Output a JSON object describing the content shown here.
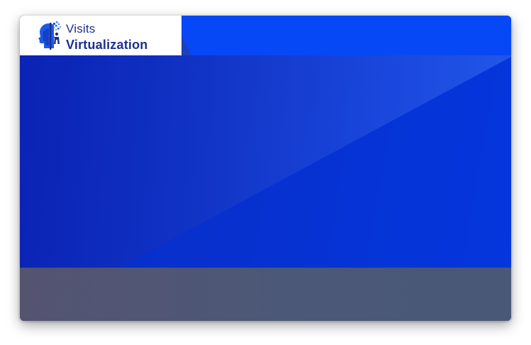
{
  "logo": {
    "line1": "Visits",
    "line2": "Virtualization",
    "icon": "head-profile-icon"
  },
  "colors": {
    "brand_blue": "#0648f5",
    "hero_dark": "#0b23b4",
    "footer": "#4b5878",
    "logo_text": "#1d2f8f"
  }
}
